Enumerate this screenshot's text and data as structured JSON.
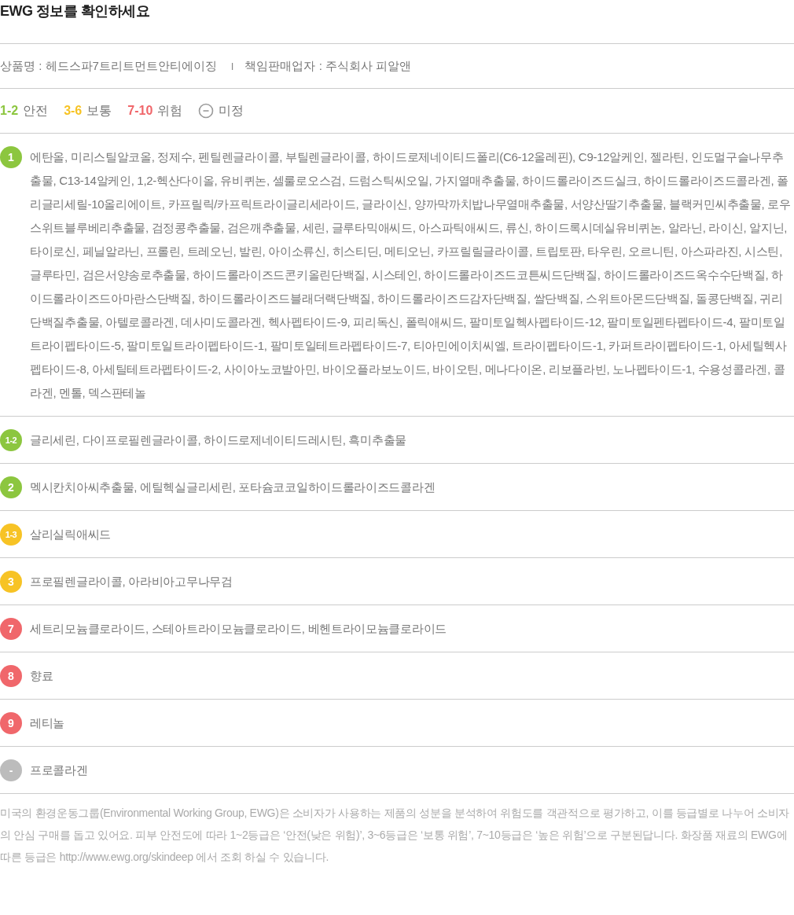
{
  "title": "EWG 정보를 확인하세요",
  "product": {
    "name_label": "상품명 : 헤드스파7트리트먼트안티에이징",
    "separator": "I",
    "seller_label": "책임판매업자 : 주식회사 피알앤"
  },
  "legend": [
    {
      "kind": "range",
      "range": "1-2",
      "label": "안전",
      "color": "#8cc63f"
    },
    {
      "kind": "range",
      "range": "3-6",
      "label": "보통",
      "color": "#f7c325"
    },
    {
      "kind": "range",
      "range": "7-10",
      "label": "위험",
      "color": "#f0676b"
    },
    {
      "kind": "unrated",
      "label": "미정",
      "color": "#9a9a9a"
    }
  ],
  "grades": [
    {
      "grade": "1",
      "color": "#8cc63f",
      "ingredients": "에탄올, 미리스틸알코올, 정제수, 펜틸렌글라이콜, 부틸렌글라이콜, 하이드로제네이티드폴리(C6-12올레핀), C9-12알케인, 젤라틴, 인도멀구슬나무추출물, C13-14알케인, 1,2-헥산다이올, 유비퀴논, 셀룰로오스검, 드럼스틱씨오일, 가지열매추출물, 하이드롤라이즈드실크, 하이드롤라이즈드콜라겐, 폴리글리세릴-10올리에이트, 카프릴릭/카프릭트라이글리세라이드, 글라이신, 양까막까치밥나무열매추출물, 서양산딸기추출물, 블랙커민씨추출물, 로우스위트블루베리추출물, 검정콩추출물, 검은깨추출물, 세린, 글루타믹애씨드, 아스파틱애씨드, 류신, 하이드록시데실유비퀴논, 알라닌, 라이신, 알지닌, 타이로신, 페닐알라닌, 프롤린, 트레오닌, 발린, 아이소류신, 히스티딘, 메티오닌, 카프릴릴글라이콜, 트립토판, 타우린, 오르니틴, 아스파라진, 시스틴, 글루타민, 검은서양송로추출물, 하이드롤라이즈드콘키올린단백질, 시스테인, 하이드롤라이즈드코튼씨드단백질, 하이드롤라이즈드옥수수단백질, 하이드롤라이즈드아마란스단백질, 하이드롤라이즈드블래더랙단백질, 하이드롤라이즈드감자단백질, 쌀단백질, 스위트아몬드단백질, 돌콩단백질, 귀리단백질추출물, 아텔로콜라겐, 데사미도콜라겐, 헥사펩타이드-9, 피리독신, 폴릭애씨드, 팔미토일헥사펩타이드-12, 팔미토일펜타펩타이드-4, 팔미토일트라이펩타이드-5, 팔미토일트라이펩타이드-1, 팔미토일테트라펩타이드-7, 티아민에이치씨엘, 트라이펩타이드-1, 카퍼트라이펩타이드-1, 아세틸헥사펩타이드-8, 아세틸테트라펩타이드-2, 사이아노코발아민, 바이오플라보노이드, 바이오틴, 메나다이온, 리보플라빈, 노나펩타이드-1, 수용성콜라겐, 콜라겐, 멘톨, 덱스판테놀"
    },
    {
      "grade": "1-2",
      "color": "#8cc63f",
      "ingredients": "글리세린, 다이프로필렌글라이콜, 하이드로제네이티드레시틴, 흑미추출물"
    },
    {
      "grade": "2",
      "color": "#8cc63f",
      "ingredients": "멕시칸치아씨추출물, 에틸헥실글리세린, 포타슘코코일하이드롤라이즈드콜라겐"
    },
    {
      "grade": "1-3",
      "color": "#f7c325",
      "ingredients": "살리실릭애씨드"
    },
    {
      "grade": "3",
      "color": "#f7c325",
      "ingredients": "프로필렌글라이콜, 아라비아고무나무검"
    },
    {
      "grade": "7",
      "color": "#f0676b",
      "ingredients": "세트리모늄클로라이드, 스테아트라이모늄클로라이드, 베헨트라이모늄클로라이드"
    },
    {
      "grade": "8",
      "color": "#f0676b",
      "ingredients": "향료"
    },
    {
      "grade": "9",
      "color": "#f0676b",
      "ingredients": "레티놀"
    },
    {
      "grade": "-",
      "color": "#bcbcbc",
      "ingredients": "프로콜라겐"
    }
  ],
  "footnote": "미국의 환경운동그룹(Environmental Working Group, EWG)은 소비자가 사용하는 제품의 성분을 분석하여 위험도를 객관적으로 평가하고, 이를 등급별로 나누어 소비자의 안심 구매를 돕고 있어요. 피부 안전도에 따라 1~2등급은 ‘안전(낮은 위험)’, 3~6등급은 ‘보통 위험’, 7~10등급은 ‘높은 위험’으로 구분된답니다. 화장품 재료의 EWG에 따른 등급은 http://www.ewg.org/skindeep 에서 조회 하실 수 있습니다."
}
